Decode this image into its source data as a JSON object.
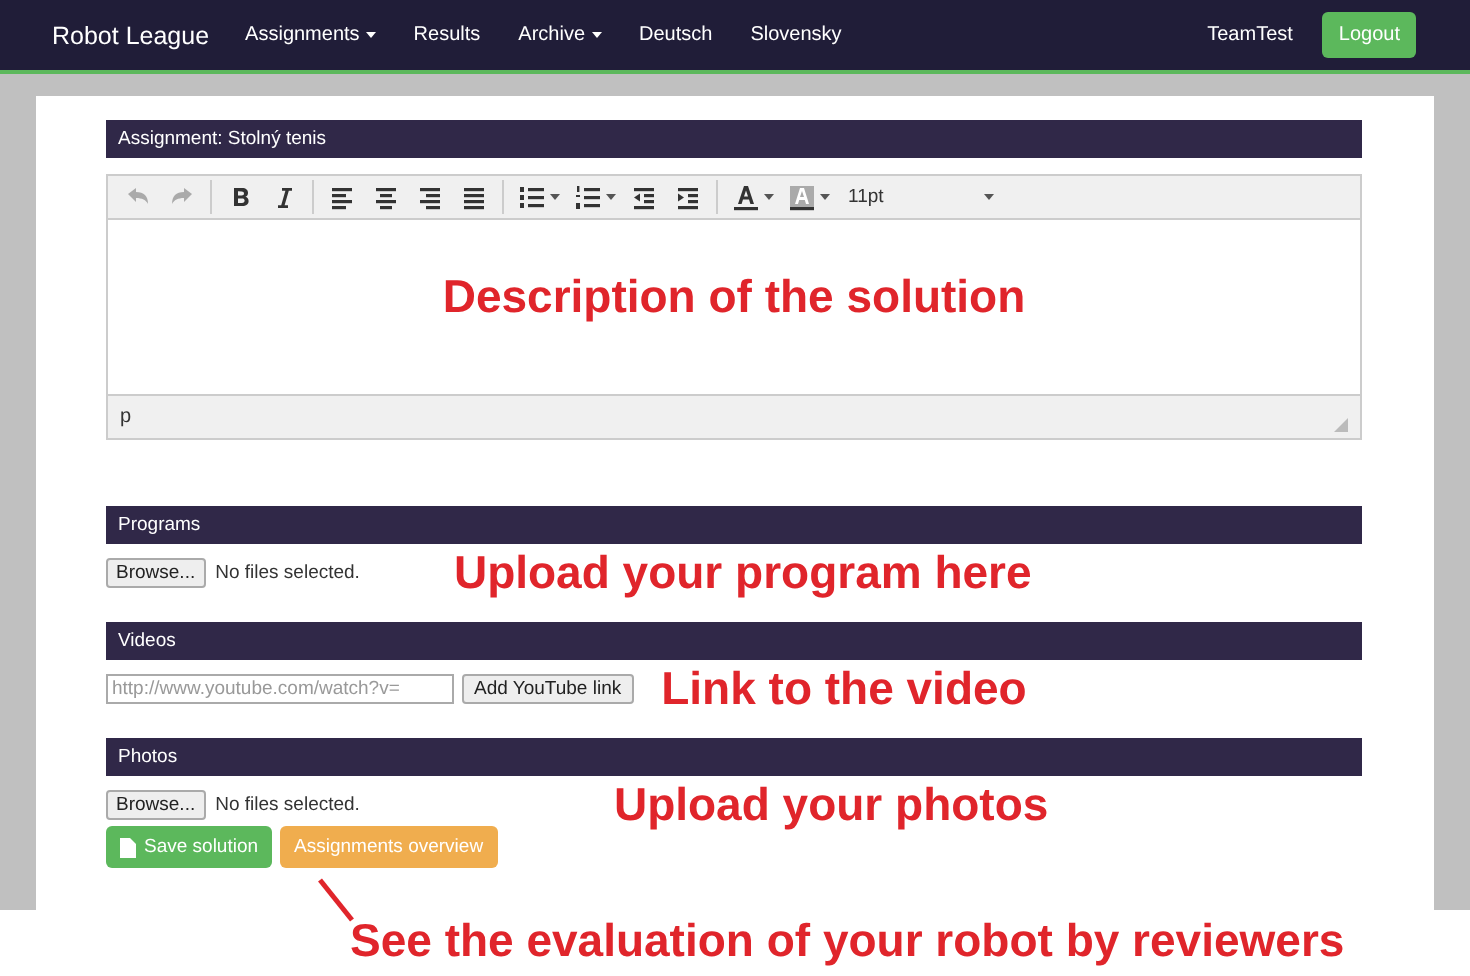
{
  "navbar": {
    "brand": "Robot League",
    "items": [
      {
        "label": "Assignments",
        "dropdown": true
      },
      {
        "label": "Results",
        "dropdown": false
      },
      {
        "label": "Archive",
        "dropdown": true
      },
      {
        "label": "Deutsch",
        "dropdown": false
      },
      {
        "label": "Slovensky",
        "dropdown": false
      }
    ],
    "user": "TeamTest",
    "logout": "Logout"
  },
  "assignment_header": "Assignment: Stolný tenis",
  "editor": {
    "toolbar": [
      {
        "kind": "undo",
        "disabled": true
      },
      {
        "kind": "redo",
        "disabled": true
      },
      {
        "kind": "sep"
      },
      {
        "kind": "bold",
        "disabled": false
      },
      {
        "kind": "italic",
        "disabled": false
      },
      {
        "kind": "sep"
      },
      {
        "kind": "align-left",
        "disabled": false
      },
      {
        "kind": "align-center",
        "disabled": false
      },
      {
        "kind": "align-right",
        "disabled": false
      },
      {
        "kind": "justify",
        "disabled": false
      },
      {
        "kind": "sep"
      },
      {
        "kind": "bullets",
        "disabled": false
      },
      {
        "kind": "numbers",
        "disabled": false
      },
      {
        "kind": "outdent",
        "disabled": false
      },
      {
        "kind": "indent",
        "disabled": false
      },
      {
        "kind": "sep"
      },
      {
        "kind": "text-color",
        "disabled": false
      },
      {
        "kind": "back-color",
        "disabled": false
      }
    ],
    "font_size": "11pt",
    "status_path": "p",
    "annotation": "Description of the solution"
  },
  "sections": [
    {
      "title": "Programs",
      "kind": "file",
      "browse": "Browse...",
      "status": "No files selected.",
      "annotation": "Upload your program here"
    },
    {
      "title": "Videos",
      "kind": "link",
      "placeholder": "http://www.youtube.com/watch?v=",
      "button": "Add YouTube link",
      "annotation": "Link to the video"
    },
    {
      "title": "Photos",
      "kind": "file",
      "browse": "Browse...",
      "status": "No files selected.",
      "annotation": "Upload your photos"
    }
  ],
  "buttons": [
    {
      "label": "Save solution",
      "kind": "success"
    },
    {
      "label": "Assignments overview",
      "kind": "warning"
    }
  ],
  "bottom_annotation": "See the evaluation of your robot by reviewers"
}
